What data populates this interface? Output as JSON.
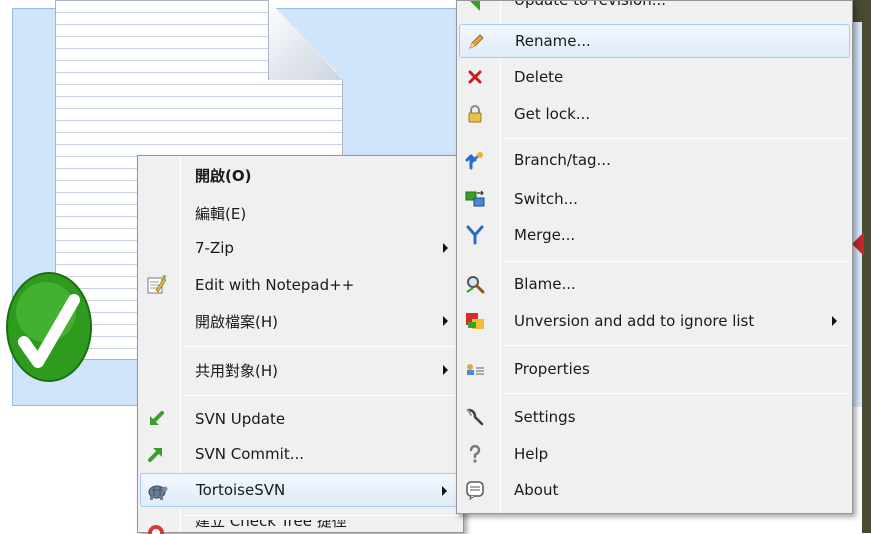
{
  "context_menu": {
    "items": [
      {
        "label": "開啟(O)",
        "icon": "none"
      },
      {
        "label": "編輯(E)",
        "icon": "none"
      },
      {
        "label": "7-Zip",
        "icon": "none"
      },
      {
        "label": "Edit with Notepad++",
        "icon": "notepad-icon"
      },
      {
        "label": "開啟檔案(H)",
        "icon": "none"
      },
      {
        "label": "共用對象(H)",
        "icon": "none"
      },
      {
        "label": "SVN Update",
        "icon": "svn-update-icon"
      },
      {
        "label": "SVN Commit...",
        "icon": "svn-commit-icon"
      },
      {
        "label": "TortoiseSVN",
        "icon": "tortoisesvn-icon"
      },
      {
        "label": "建立 Check Tree 捷徑",
        "icon": "checktree-icon"
      }
    ]
  },
  "tortoise_submenu": {
    "items": [
      {
        "label": "Update to revision...",
        "icon": "update-revision-icon"
      },
      {
        "label": "Rename...",
        "icon": "pencil-icon"
      },
      {
        "label": "Delete",
        "icon": "delete-x-icon"
      },
      {
        "label": "Get lock...",
        "icon": "lock-icon"
      },
      {
        "label": "Branch/tag...",
        "icon": "branch-icon"
      },
      {
        "label": "Switch...",
        "icon": "switch-icon"
      },
      {
        "label": "Merge...",
        "icon": "merge-icon"
      },
      {
        "label": "Blame...",
        "icon": "blame-icon"
      },
      {
        "label": "Unversion and add to ignore list",
        "icon": "ignore-icon"
      },
      {
        "label": "Properties",
        "icon": "properties-icon"
      },
      {
        "label": "Settings",
        "icon": "settings-icon"
      },
      {
        "label": "Help",
        "icon": "help-icon"
      },
      {
        "label": "About",
        "icon": "about-icon"
      }
    ]
  },
  "colors": {
    "menu_bg": "#f0f0f0",
    "highlight_border": "#a9cbf0",
    "selection_bg": "#cfe5fb",
    "checkmark_green": "#2e9a1e"
  }
}
